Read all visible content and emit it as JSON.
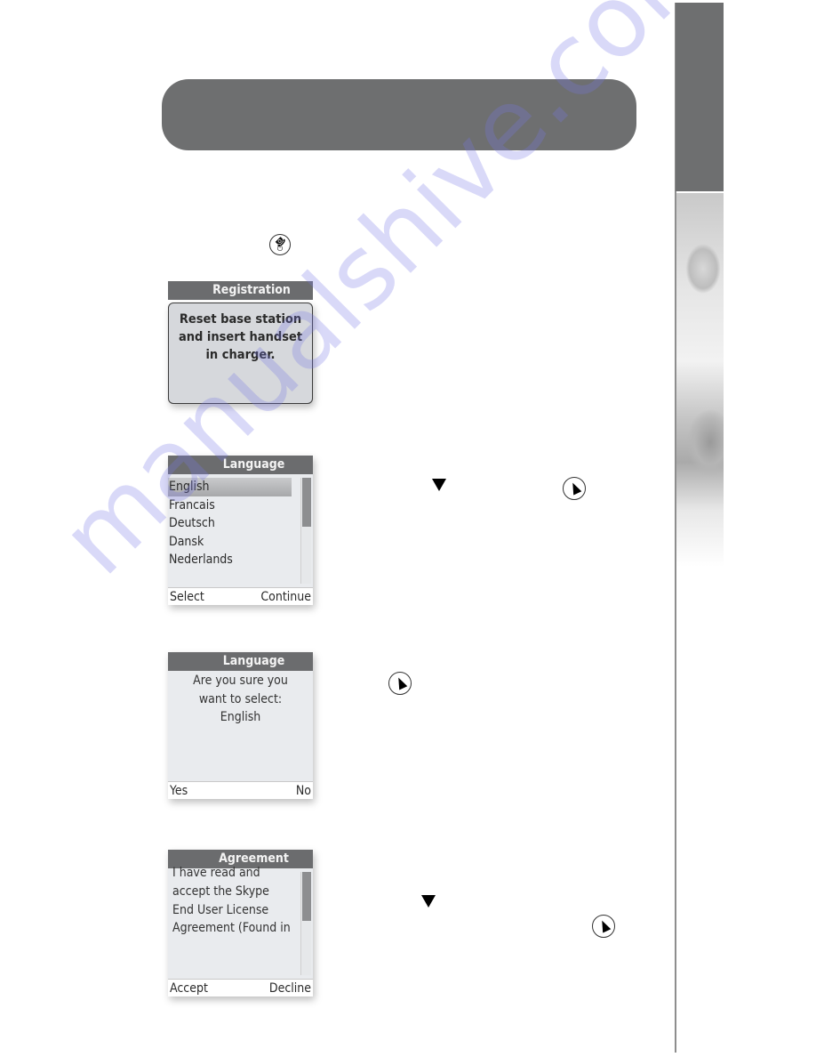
{
  "page": {
    "title_bar_text": "",
    "watermark": "manualshive.com"
  },
  "icons": {
    "power_key": "end-call-power-icon",
    "nav_key": "navigation-select-key-icon",
    "down_arrow": "down-arrow-icon"
  },
  "colors": {
    "title_bar": "#6e6f70",
    "screen_header": "#6b6c6e",
    "screen_body": "#e9ebee",
    "watermark": "#8787e6"
  },
  "screens": {
    "registration": {
      "title": "Registration",
      "lines": [
        "Reset base station",
        "and insert handset",
        "in charger."
      ]
    },
    "language": {
      "title": "Language",
      "items": [
        "English",
        "Francais",
        "Deutsch",
        "Dansk",
        "Nederlands"
      ],
      "selected_index": 0,
      "softkey_left": "Select",
      "softkey_right": "Continue"
    },
    "confirm": {
      "title": "Language",
      "lines": [
        "Are you sure you",
        "want to select:",
        "English"
      ],
      "softkey_left": "Yes",
      "softkey_right": "No"
    },
    "agreement": {
      "title": "Agreement",
      "lines": [
        "I have read and",
        "accept the Skype",
        "End User License",
        "Agreement (Found in"
      ],
      "softkey_left": "Accept",
      "softkey_right": "Decline"
    }
  }
}
